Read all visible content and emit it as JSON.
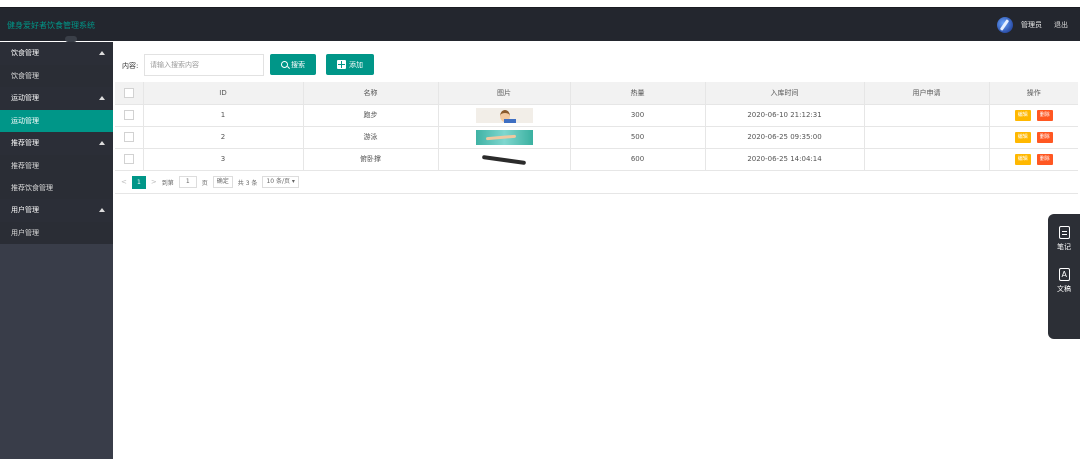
{
  "app": {
    "title": "健身爱好者饮食管理系统",
    "user": "管理员",
    "logout": "退出"
  },
  "sidebar": {
    "groups": [
      {
        "label": "饮食管理",
        "items": [
          {
            "label": "饮食管理",
            "active": false
          }
        ]
      },
      {
        "label": "运动管理",
        "items": [
          {
            "label": "运动管理",
            "active": true
          }
        ]
      },
      {
        "label": "推荐管理",
        "items": [
          {
            "label": "推荐管理",
            "active": false
          },
          {
            "label": "推荐饮食管理",
            "active": false
          }
        ]
      },
      {
        "label": "用户管理",
        "items": [
          {
            "label": "用户管理",
            "active": false
          }
        ]
      }
    ]
  },
  "toolbar": {
    "content_label": "内容:",
    "search_placeholder": "请输入搜索内容",
    "search_value": "",
    "search_button": "搜索",
    "add_button": "添加"
  },
  "table": {
    "columns": [
      "",
      "ID",
      "名称",
      "图片",
      "热量",
      "入库时间",
      "用户申请",
      "操作"
    ],
    "rows": [
      {
        "id": "1",
        "name": "跑步",
        "image": "running",
        "calories": "300",
        "time": "2020-06-10 21:12:31",
        "apply": ""
      },
      {
        "id": "2",
        "name": "游泳",
        "image": "swimming",
        "calories": "500",
        "time": "2020-06-25 09:35:00",
        "apply": ""
      },
      {
        "id": "3",
        "name": "俯卧撑",
        "image": "pushup",
        "calories": "600",
        "time": "2020-06-25 14:04:14",
        "apply": ""
      }
    ],
    "edit_label": "编辑",
    "delete_label": "删除"
  },
  "pager": {
    "prev": "<",
    "current": "1",
    "next": ">",
    "goto_label": "到第",
    "goto_value": "1",
    "page_unit": "页",
    "confirm": "确定",
    "total": "共 3 条",
    "page_size": "10 条/页"
  },
  "float_panel": {
    "note": "笔记",
    "doc": "文稿"
  },
  "colors": {
    "accent": "#009688",
    "header": "#23262e",
    "sidebar": "#393d49",
    "edit": "#ffb800",
    "delete": "#ff5722"
  }
}
